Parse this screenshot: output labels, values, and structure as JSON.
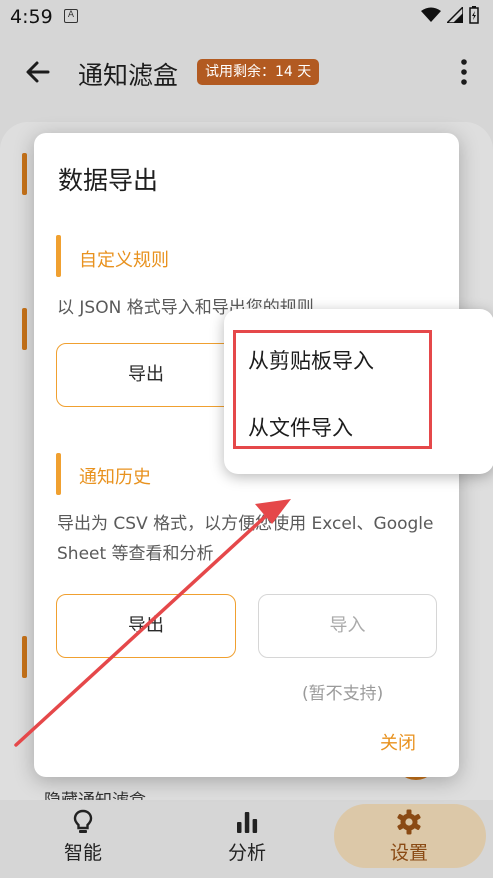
{
  "status_bar": {
    "time": "4:59",
    "app_icon_letter": "A"
  },
  "app_bar": {
    "title": "通知滤盒",
    "trial_badge": "试用剩余：14 天"
  },
  "dialog": {
    "title": "数据导出",
    "custom_rules": {
      "title": "自定义规则",
      "description": "以 JSON 格式导入和导出您的规则",
      "export_label": "导出"
    },
    "history": {
      "title": "通知历史",
      "description": "导出为 CSV 格式，以方便您使用 Excel、Google Sheet 等查看和分析",
      "export_label": "导出",
      "import_label": "导入",
      "not_supported": "(暂不支持)"
    },
    "close_label": "关闭"
  },
  "popup_menu": {
    "items": [
      {
        "label": "从剪贴板导入"
      },
      {
        "label": "从文件导入"
      }
    ]
  },
  "background": {
    "hidden_text": "隐藏通知滤盒"
  },
  "bottom_nav": {
    "items": [
      {
        "label": "智能",
        "icon": "lightbulb-icon"
      },
      {
        "label": "分析",
        "icon": "bar-chart-icon"
      },
      {
        "label": "设置",
        "icon": "gear-icon",
        "active": true
      }
    ]
  },
  "colors": {
    "accent": "#f0a030",
    "badge": "#b25a21",
    "annotation": "#e5484a",
    "active_pill": "#dcc8a8"
  }
}
